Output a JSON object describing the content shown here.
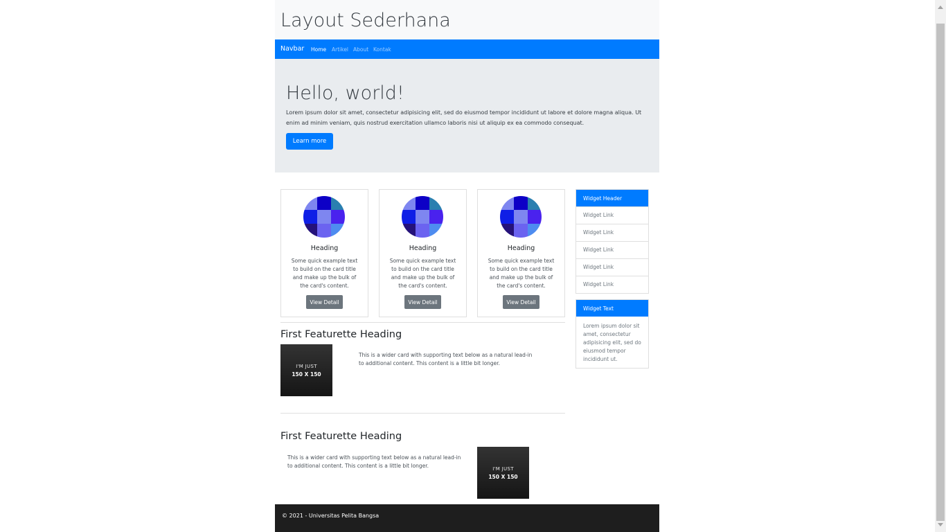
{
  "header": {
    "title": "Layout Sederhana"
  },
  "navbar": {
    "brand": "Navbar",
    "links": [
      {
        "label": "Home",
        "active": true
      },
      {
        "label": "Artikel",
        "active": false
      },
      {
        "label": "About",
        "active": false
      },
      {
        "label": "Kontak",
        "active": false
      }
    ]
  },
  "jumbotron": {
    "title": "Hello, world!",
    "text": "Lorem ipsum dolor sit amet, consectetur adipisicing elit, sed do eiusmod tempor incididunt ut labore et dolore magna aliqua. Ut enim ad minim veniam, quis nostrud exercitation ullamco laboris nisi ut aliquip ex ea commodo consequat.",
    "button_label": "Learn more"
  },
  "cards": [
    {
      "heading": "Heading",
      "text": "Some quick example text to build on the card title and make up the bulk of the card's content.",
      "button_label": "View Detail"
    },
    {
      "heading": "Heading",
      "text": "Some quick example text to build on the card title and make up the bulk of the card's content.",
      "button_label": "View Detail"
    },
    {
      "heading": "Heading",
      "text": "Some quick example text to build on the card title and make up the bulk of the card's content.",
      "button_label": "View Detail"
    }
  ],
  "card_image_colors": [
    "#7e86f0",
    "#0d00c6",
    "#2a7fb0",
    "#0f1fe6",
    "#7e86f0",
    "#4a22ee",
    "#25127a",
    "#6b63f0",
    "#4e8cf0"
  ],
  "featurettes": [
    {
      "heading": "First Featurette Heading",
      "text": "This is a wider card with supporting text below as a natural lead-in to additional content. This content is a little bit longer.",
      "image_line1": "I'M JUST",
      "image_line2": "150 X 150"
    },
    {
      "heading": "First Featurette Heading",
      "text": "This is a wider card with supporting text below as a natural lead-in to additional content. This content is a little bit longer.",
      "image_line1": "I'M JUST",
      "image_line2": "150 X 150"
    }
  ],
  "sidebar": {
    "widget_links": {
      "header": "Widget Header",
      "links": [
        "Widget Link",
        "Widget Link",
        "Widget Link",
        "Widget Link",
        "Widget Link"
      ]
    },
    "widget_text": {
      "header": "Widget Text",
      "body": "Lorem ipsum dolor sit amet, consectetur adipisicing elit, sed do eiusmod tempor incididunt ut."
    }
  },
  "footer": {
    "text": "© 2021 - Universitas Pelita Bangsa"
  },
  "colors": {
    "primary": "#007bff",
    "secondary": "#6c757d",
    "jumbotron_bg": "#e9ecef",
    "footer_bg": "#1e1e1e"
  }
}
